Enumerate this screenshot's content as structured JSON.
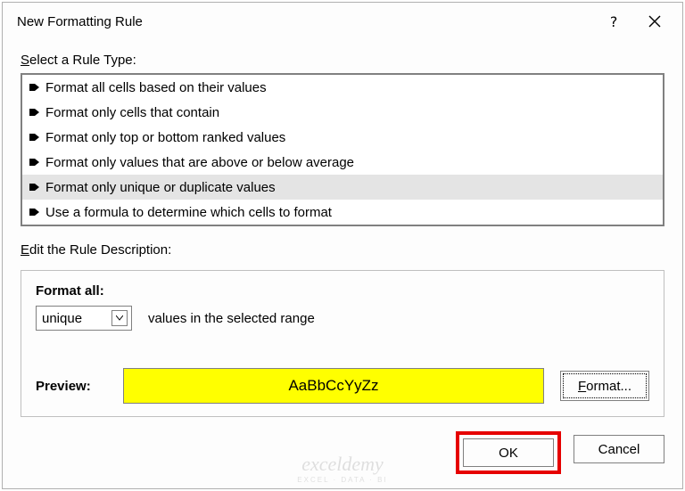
{
  "title": "New Formatting Rule",
  "help_glyph": "?",
  "section_select_label_pre": "S",
  "section_select_label_rest": "elect a Rule Type:",
  "rule_types": [
    {
      "label": "Format all cells based on their values",
      "selected": false
    },
    {
      "label": "Format only cells that contain",
      "selected": false
    },
    {
      "label": "Format only top or bottom ranked values",
      "selected": false
    },
    {
      "label": "Format only values that are above or below average",
      "selected": false
    },
    {
      "label": "Format only unique or duplicate values",
      "selected": true
    },
    {
      "label": "Use a formula to determine which cells to format",
      "selected": false
    }
  ],
  "section_edit_label_pre": "E",
  "section_edit_label_rest": "dit the Rule Description:",
  "format_all_label_pre": "F",
  "format_all_label_mid": "o",
  "format_all_label_rest": "rmat all:",
  "combo_value": "unique",
  "combo_suffix": "values in the selected range",
  "preview_label": "Preview:",
  "preview_sample": "AaBbCcYyZz",
  "format_btn_pre": "F",
  "format_btn_rest": "ormat...",
  "ok_label": "OK",
  "cancel_label": "Cancel",
  "watermark_brand": "exceldemy",
  "watermark_sub": "EXCEL · DATA · BI",
  "colors": {
    "highlight": "#ffff00",
    "annotation": "#e60000"
  }
}
